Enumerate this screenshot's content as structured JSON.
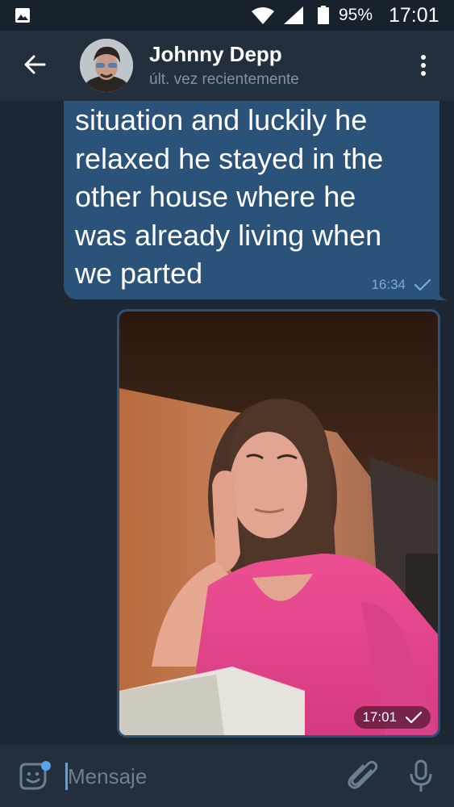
{
  "status_bar": {
    "battery": "95%",
    "time": "17:01",
    "icons": [
      "gallery-icon",
      "wifi-icon",
      "signal-icon",
      "battery-icon"
    ]
  },
  "header": {
    "contact_name": "Johnny Depp",
    "contact_status": "últ. vez recientemente",
    "icons": [
      "back-arrow-icon",
      "more-vertical-icon"
    ]
  },
  "messages": [
    {
      "type": "text",
      "lines": [
        "situation and luckily he",
        "relaxed he stayed in the",
        "other house where he",
        "was already living when",
        "we parted"
      ],
      "time": "16:34",
      "status": "sent"
    },
    {
      "type": "photo",
      "description_icon": "photo",
      "time": "17:01",
      "status": "sent"
    }
  ],
  "input_bar": {
    "placeholder": "Mensaje",
    "icons": [
      "sticker-icon",
      "attach-icon",
      "mic-icon"
    ]
  },
  "colors": {
    "background": "#1d2733",
    "header": "#242f3d",
    "outgoing_bubble": "#2b5278",
    "accent": "#5aa3e8",
    "secondary_text": "#7f92a6"
  }
}
